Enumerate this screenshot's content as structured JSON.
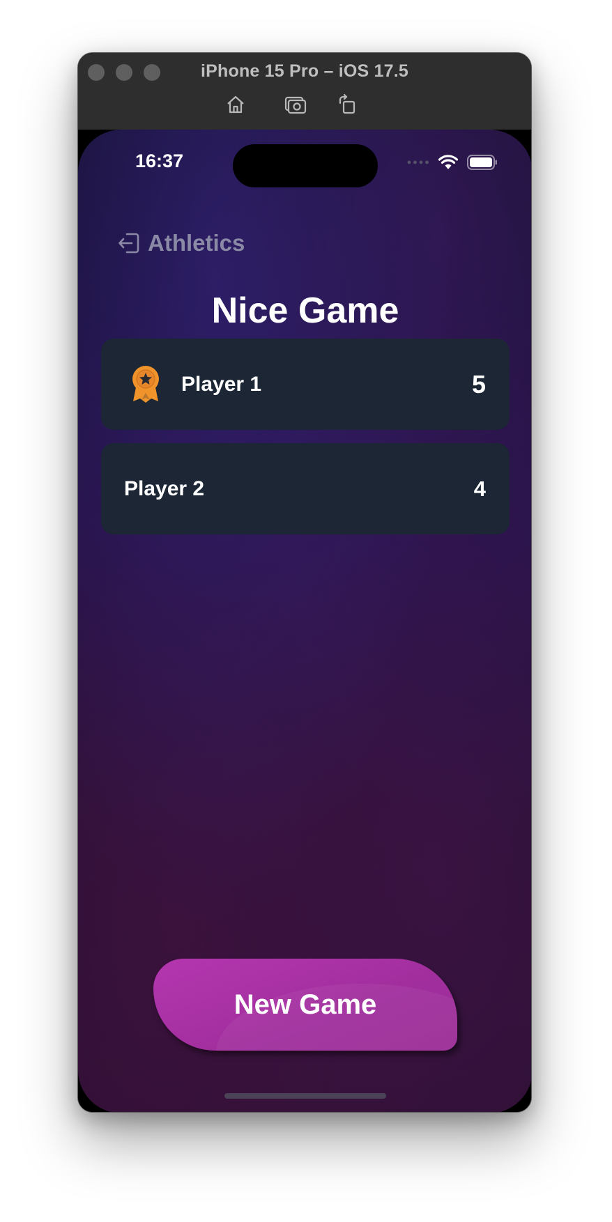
{
  "window": {
    "title": "iPhone 15 Pro – iOS 17.5",
    "toolbar": [
      "home-icon",
      "screenshot-icon",
      "rotate-icon"
    ]
  },
  "status_bar": {
    "time": "16:37",
    "icons": [
      "signal-dots-icon",
      "wifi-icon",
      "battery-icon"
    ]
  },
  "nav": {
    "back_label": "Athletics",
    "back_icon": "exit-icon"
  },
  "page": {
    "title": "Nice Game"
  },
  "players": [
    {
      "name": "Player 1",
      "score": "5",
      "badge": "medal-icon",
      "winner": true
    },
    {
      "name": "Player 2",
      "score": "4",
      "winner": false
    }
  ],
  "actions": {
    "new_game_label": "New Game"
  },
  "colors": {
    "card_bg": "#1c2635",
    "button_bg": "#a82fa3",
    "medal": "#f0932b",
    "back_text": "#8b8aa6"
  }
}
